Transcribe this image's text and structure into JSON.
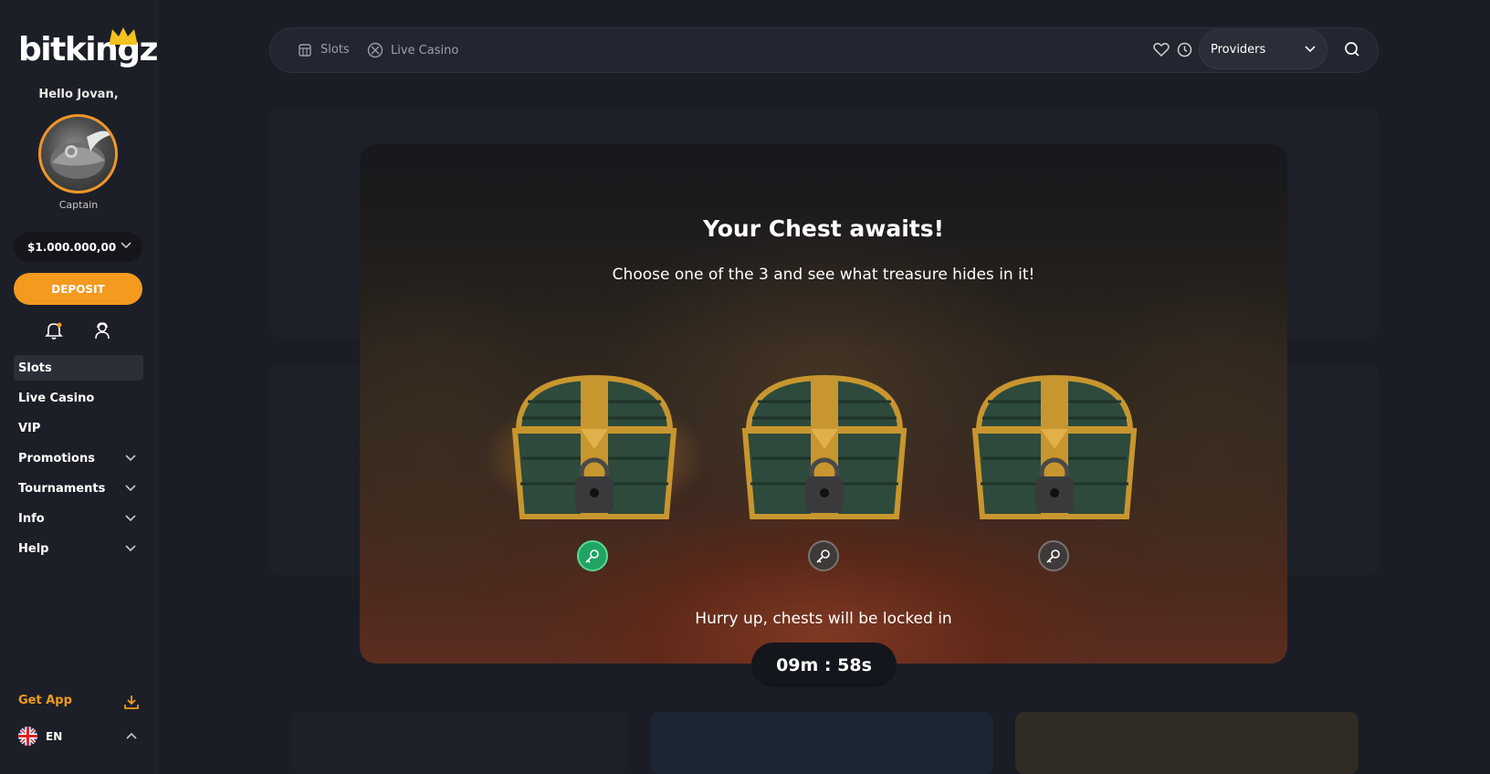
{
  "brand": {
    "logo_text": "bitkingz"
  },
  "user": {
    "greeting": "Hello Jovan,",
    "rank": "Captain",
    "balance": "$1.000.000,00"
  },
  "sidebar": {
    "deposit_label": "DEPOSIT",
    "items": [
      {
        "label": "Slots",
        "active": true,
        "expandable": false
      },
      {
        "label": "Live Casino",
        "active": false,
        "expandable": false
      },
      {
        "label": "VIP",
        "active": false,
        "expandable": false
      },
      {
        "label": "Promotions",
        "active": false,
        "expandable": true
      },
      {
        "label": "Tournaments",
        "active": false,
        "expandable": true
      },
      {
        "label": "Info",
        "active": false,
        "expandable": true
      },
      {
        "label": "Help",
        "active": false,
        "expandable": true
      }
    ],
    "get_app_label": "Get App",
    "language": "EN"
  },
  "topbar": {
    "links": [
      {
        "label": "Slots",
        "icon": "slot-machine-icon"
      },
      {
        "label": "Live Casino",
        "icon": "chip-icon"
      }
    ],
    "providers_label": "Providers"
  },
  "modal": {
    "title": "Your Chest awaits!",
    "subtitle": "Choose one of the 3 and see what treasure hides in it!",
    "chests": [
      {
        "selected": true
      },
      {
        "selected": false
      },
      {
        "selected": false
      }
    ],
    "hurry_text": "Hurry up, chests will be locked in",
    "timer": "09m : 58s"
  },
  "colors": {
    "accent": "#f39a1f",
    "sidebar_bg": "#1c1f27",
    "selected_key": "#20a463",
    "avatar_ring": "#f0962a"
  }
}
